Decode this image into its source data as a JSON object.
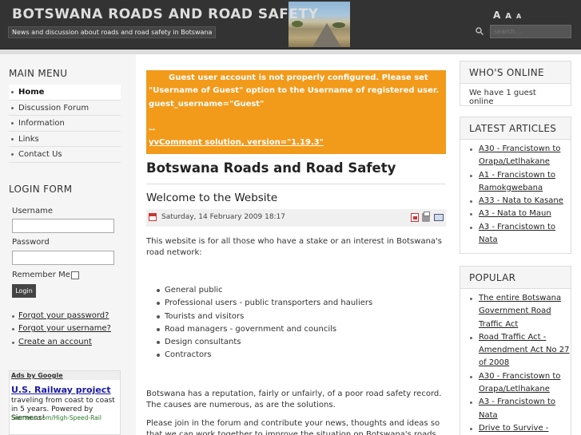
{
  "header": {
    "site_title": "BOTSWANA ROADS AND ROAD SAFETY",
    "tagline": "News and discussion about roads and road safety in Botswana",
    "font_sizer": [
      "A",
      "A",
      "A"
    ],
    "search_placeholder": "search...",
    "search_icon": "search-icon"
  },
  "main_menu": {
    "title": "MAIN MENU",
    "items": [
      "Home",
      "Discussion Forum",
      "Information",
      "Links",
      "Contact Us"
    ],
    "active": "Home"
  },
  "login_form": {
    "title": "LOGIN FORM",
    "username_label": "Username",
    "password_label": "Password",
    "remember_label": "Remember Me",
    "login_button": "Login",
    "links": [
      "Forgot your password?",
      "Forgot your username?",
      "Create an account"
    ]
  },
  "ads": {
    "header": "Ads by Google",
    "title": "U.S. Railway project",
    "body": "traveling from coast to coast in 5 years. Powered by Siemens!",
    "url": "Siemens.com/High-Speed-Rail"
  },
  "notice": {
    "line1": "Guest user account is not properly configured. Please set",
    "line2": "\"Username of Guest\" option to the Username of registered user.",
    "line3": "guest_username=\"Guest\"",
    "line4": "--",
    "line5": "yvComment solution, version=\"1.19.3\""
  },
  "content": {
    "page_title": "Botswana Roads and Road Safety",
    "article_title": "Welcome to the Website",
    "date": "Saturday, 14 February 2009 18:17",
    "intro_line1": "This website is for all those who have a stake or an interest in Botswana's",
    "intro_line2": "road network:",
    "bullets": [
      "General public",
      "Professional users - public transporters and hauliers",
      "Tourists and visitors",
      "Road managers - government and councils",
      "Design consultants",
      "Contractors"
    ],
    "para2_line1": "Botswana has a reputation, fairly or unfairly, of a poor road safety record.",
    "para2_line2": " The causes are numerous, as are the solutions.",
    "para3_line1": "Please join in the forum and contribute your news, thoughts and ideas so",
    "para3_line2": "that we can work together to improve the situation on Botswana's roads."
  },
  "whos_online": {
    "title": "WHO'S ONLINE",
    "text": "We have 1 guest online"
  },
  "latest_articles": {
    "title": "LATEST ARTICLES",
    "items": [
      "A30 - Francistown to Orapa/Letlhakane",
      "A1 - Francistown to Ramokgwebana",
      "A33 - Nata to Kasane",
      "A3 - Nata to Maun",
      "A3 - Francistown to Nata"
    ]
  },
  "popular": {
    "title": "POPULAR",
    "items": [
      "The entire Botswana Government Road Traffic Act",
      "Road Traffic Act - Amendment Act No 27 of 2008",
      "A30 - Francistown to Orapa/Letlhakane",
      "A3 - Francistown to Nata",
      "Drive to Survive -"
    ]
  }
}
